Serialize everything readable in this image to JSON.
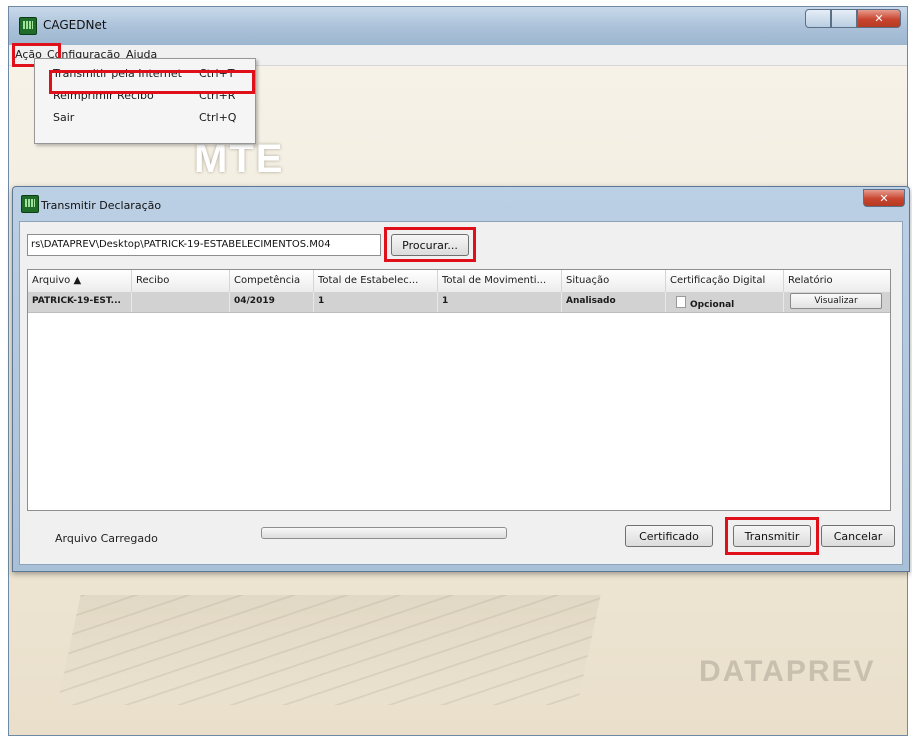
{
  "main_window": {
    "title": "CAGEDNet",
    "menu": [
      "Ação",
      "Configuração",
      "Ajuda"
    ]
  },
  "dropdown": {
    "items": [
      {
        "label": "Transmitir pela Internet",
        "shortcut": "Ctrl+T"
      },
      {
        "label": "Reimprimir Recibo",
        "shortcut": "Ctrl+R"
      },
      {
        "label": "Sair",
        "shortcut": "Ctrl+Q"
      }
    ]
  },
  "background": {
    "logo_top": "MTE",
    "logo_bottom": "DATAPREV"
  },
  "dialog": {
    "title": "Transmitir Declaração",
    "file_path": "rs\\DATAPREV\\Desktop\\PATRICK-19-ESTABELECIMENTOS.M04",
    "browse_label": "Procurar...",
    "columns": [
      "Arquivo ▲",
      "Recibo",
      "Competência",
      "Total de Estabelec...",
      "Total de Movimenti...",
      "Situação",
      "Certificação Digital",
      "Relatório"
    ],
    "rows": [
      {
        "arquivo": "PATRICK-19-EST...",
        "recibo": "",
        "competencia": "04/2019",
        "total_estab": "1",
        "total_mov": "1",
        "situacao": "Analisado",
        "certificacao": "Opcional",
        "relatorio": "Visualizar"
      }
    ],
    "status_label": "Arquivo Carregado",
    "progress_fraction": 0,
    "buttons": {
      "certificado": "Certificado",
      "transmitir": "Transmitir",
      "cancelar": "Cancelar"
    }
  },
  "colors": {
    "highlight": "#e0101b",
    "titlebar": "#aac1d9",
    "selected_row": "#d2d2d2"
  }
}
